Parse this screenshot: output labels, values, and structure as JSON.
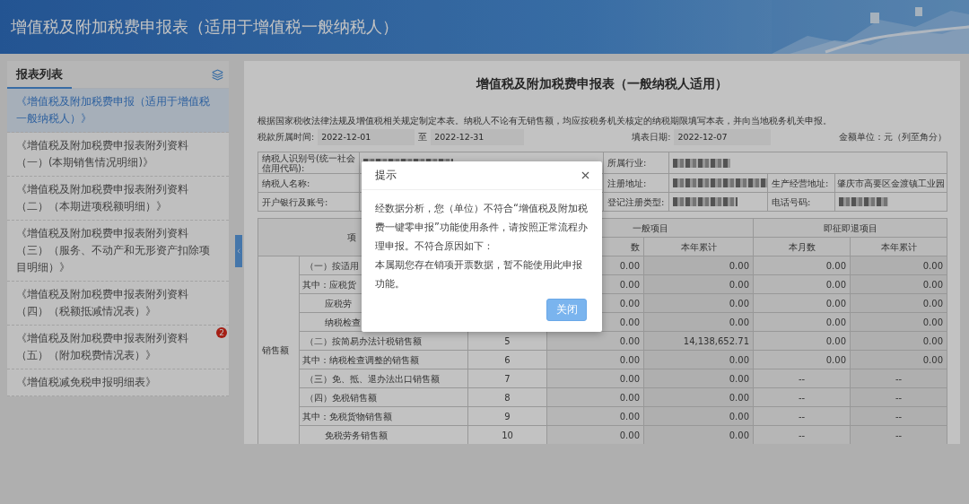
{
  "header": {
    "title": "增值税及附加税费申报表（适用于增值税一般纳税人）"
  },
  "sidebar": {
    "title": "报表列表",
    "items": [
      {
        "label": "《增值税及附加税费申报（适用于增值税一般纳税人）》",
        "selected": true
      },
      {
        "label": "《增值税及附加税费申报表附列资料（一）(本期销售情况明细)》",
        "selected": false
      },
      {
        "label": "《增值税及附加税费申报表附列资料（二）（本期进项税额明细）》",
        "selected": false
      },
      {
        "label": "《增值税及附加税费申报表附列资料（三）（服务、不动产和无形资产扣除项目明细）》",
        "selected": false
      },
      {
        "label": "《增值税及附加税费申报表附列资料（四）（税额抵减情况表）》",
        "selected": false
      },
      {
        "label": "《增值税及附加税费申报表附列资料（五）（附加税费情况表）》",
        "selected": false,
        "badge": "2"
      },
      {
        "label": "《增值税减免税申报明细表》",
        "selected": false
      }
    ]
  },
  "form": {
    "title": "增值税及附加税费申报表（一般纳税人适用）",
    "note": "根据国家税收法律法规及增值税相关规定制定本表。纳税人不论有无销售额，均应按税务机关核定的纳税期限填写本表，并向当地税务机关申报。",
    "period_label": "税款所属时间:",
    "period_start": "2022-12-01",
    "period_sep": "至",
    "period_end": "2022-12-31",
    "fill_date_label": "填表日期:",
    "fill_date": "2022-12-07",
    "unit": "金额单位：元（列至角分）"
  },
  "info": {
    "taxpayer_id_label": "纳税人识别号(统一社会信用代码):",
    "industry_label": "所属行业:",
    "name_label": "纳税人名称:",
    "reg_address_label": "注册地址:",
    "business_address_label": "生产经营地址:",
    "business_address": "肇庆市高要区金渡镇工业园",
    "bank_label": "开户银行及账号:",
    "reg_type_label": "登记注册类型:",
    "phone_label": "电话号码:"
  },
  "table": {
    "item_header": "项",
    "general_header": "一般项目",
    "refund_header": "即征即退项目",
    "subheaders": [
      "数",
      "本年累计",
      "本月数",
      "本年累计"
    ],
    "category": "销售额",
    "rows": [
      {
        "kind": "section",
        "label": "（一）按适用",
        "values": [
          "0.00",
          "0.00",
          "0.00",
          "0.00"
        ]
      },
      {
        "kind": "of_which",
        "label": "其中：应税货",
        "values": [
          "0.00",
          "0.00",
          "0.00",
          "0.00"
        ]
      },
      {
        "kind": "sub",
        "label": "应税劳",
        "values": [
          "0.00",
          "0.00",
          "0.00",
          "0.00"
        ]
      },
      {
        "kind": "sub",
        "label": "纳税检查",
        "values": [
          "0.00",
          "0.00",
          "0.00",
          "0.00"
        ]
      },
      {
        "kind": "section",
        "label": "（二）按简易办法计税销售额",
        "line": "5",
        "values": [
          "0.00",
          "14,138,652.71",
          "0.00",
          "0.00"
        ]
      },
      {
        "kind": "of_which",
        "label": "其中：纳税检查调整的销售额",
        "line": "6",
        "values": [
          "0.00",
          "0.00",
          "0.00",
          "0.00"
        ]
      },
      {
        "kind": "section",
        "label": "（三）免、抵、退办法出口销售额",
        "line": "7",
        "values": [
          "0.00",
          "0.00",
          "--",
          "--"
        ]
      },
      {
        "kind": "section",
        "label": "（四）免税销售额",
        "line": "8",
        "values": [
          "0.00",
          "0.00",
          "--",
          "--"
        ]
      },
      {
        "kind": "of_which",
        "label": "其中：免税货物销售额",
        "line": "9",
        "values": [
          "0.00",
          "0.00",
          "--",
          "--"
        ]
      },
      {
        "kind": "sub",
        "label": "免税劳务销售额",
        "line": "10",
        "values": [
          "0.00",
          "0.00",
          "--",
          "--"
        ]
      }
    ]
  },
  "modal": {
    "title": "提示",
    "paragraphs": [
      "经数据分析，您（单位）不符合“增值税及附加税费一键零申报”功能使用条件，请按照正常流程办理申报。不符合原因如下：",
      "本属期您存在销项开票数据，暂不能使用此申报功能。"
    ],
    "close_button": "关闭"
  }
}
